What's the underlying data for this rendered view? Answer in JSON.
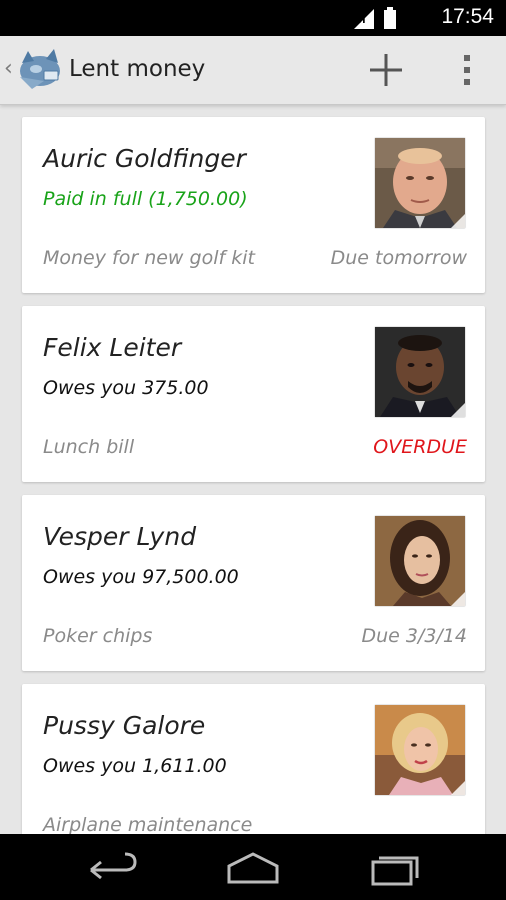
{
  "status_bar": {
    "time": "17:54"
  },
  "action_bar": {
    "title": "Lent money",
    "icons": [
      "up-caret",
      "app-logo",
      "add-icon",
      "overflow-menu-icon"
    ]
  },
  "loans": [
    {
      "name": "Auric Goldfinger",
      "status": "Paid in full (1,750.00)",
      "status_type": "paid",
      "note": "Money for new golf kit",
      "due": "Due tomorrow",
      "due_type": "normal"
    },
    {
      "name": "Felix Leiter",
      "status": "Owes you 375.00",
      "status_type": "owes",
      "note": "Lunch bill",
      "due": "OVERDUE",
      "due_type": "overdue"
    },
    {
      "name": "Vesper Lynd",
      "status": "Owes you 97,500.00",
      "status_type": "owes",
      "note": "Poker chips",
      "due": "Due 3/3/14",
      "due_type": "normal"
    },
    {
      "name": "Pussy Galore",
      "status": "Owes you 1,611.00",
      "status_type": "owes",
      "note": "Airplane  maintenance",
      "due": "",
      "due_type": "normal"
    }
  ],
  "colors": {
    "paid": "#19a319",
    "overdue": "#e0161b",
    "muted_text": "#8a8a8a",
    "background": "#e6e6e6"
  },
  "nav_bar": {
    "icons": [
      "back-icon",
      "home-icon",
      "recent-apps-icon"
    ]
  }
}
